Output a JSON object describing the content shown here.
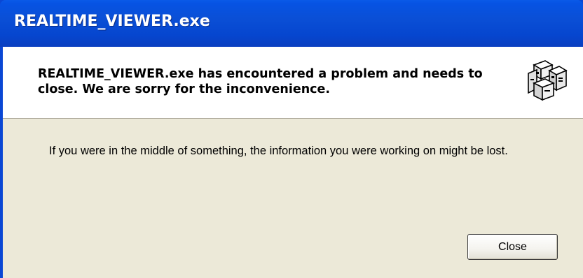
{
  "window": {
    "title": "REALTIME_VIEWER.exe"
  },
  "header": {
    "message": "REALTIME_VIEWER.exe has encountered a problem and needs to close.  We are sorry for the inconvenience.",
    "icon": "application-error-icon"
  },
  "body": {
    "message": "If you were in the middle of something, the information you were working on might be lost."
  },
  "buttons": {
    "close_label": "Close"
  },
  "colors": {
    "titlebar": "#0a4fd6",
    "dialog_background": "#ece9d8",
    "header_background": "#ffffff"
  }
}
